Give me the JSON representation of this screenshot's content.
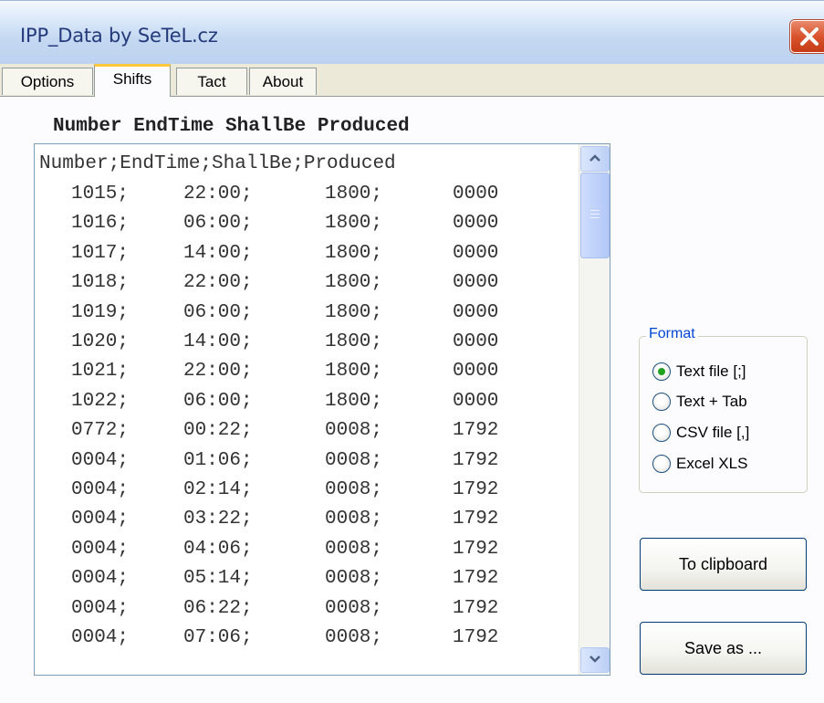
{
  "window": {
    "title": "IPP_Data by SeTeL.cz"
  },
  "tabs": [
    {
      "label": "Options"
    },
    {
      "label": "Shifts"
    },
    {
      "label": "Tact"
    },
    {
      "label": "About"
    }
  ],
  "columns_header": "Number EndTime ShallBe Produced",
  "list": {
    "header_line": "Number;EndTime;ShallBe;Produced",
    "rows": [
      [
        "1015;",
        "22:00;",
        "1800;",
        "0000"
      ],
      [
        "1016;",
        "06:00;",
        "1800;",
        "0000"
      ],
      [
        "1017;",
        "14:00;",
        "1800;",
        "0000"
      ],
      [
        "1018;",
        "22:00;",
        "1800;",
        "0000"
      ],
      [
        "1019;",
        "06:00;",
        "1800;",
        "0000"
      ],
      [
        "1020;",
        "14:00;",
        "1800;",
        "0000"
      ],
      [
        "1021;",
        "22:00;",
        "1800;",
        "0000"
      ],
      [
        "1022;",
        "06:00;",
        "1800;",
        "0000"
      ],
      [
        "0772;",
        "00:22;",
        "0008;",
        "1792"
      ],
      [
        "0004;",
        "01:06;",
        "0008;",
        "1792"
      ],
      [
        "0004;",
        "02:14;",
        "0008;",
        "1792"
      ],
      [
        "0004;",
        "03:22;",
        "0008;",
        "1792"
      ],
      [
        "0004;",
        "04:06;",
        "0008;",
        "1792"
      ],
      [
        "0004;",
        "05:14;",
        "0008;",
        "1792"
      ],
      [
        "0004;",
        "06:22;",
        "0008;",
        "1792"
      ],
      [
        "0004;",
        "07:06;",
        "0008;",
        "1792"
      ]
    ]
  },
  "format": {
    "label": "Format",
    "options": [
      {
        "label": "Text file [;]",
        "selected": true
      },
      {
        "label": "Text + Tab",
        "selected": false
      },
      {
        "label": "CSV file [,]",
        "selected": false
      },
      {
        "label": "Excel XLS",
        "selected": false
      }
    ]
  },
  "buttons": {
    "clipboard": "To clipboard",
    "save": "Save as ..."
  },
  "colors": {
    "title_text": "#243a7a",
    "close_button": "#d9532d",
    "active_tab_accent": "#ffc83c",
    "group_label": "#0046d5",
    "radio_selected": "#21a121"
  }
}
